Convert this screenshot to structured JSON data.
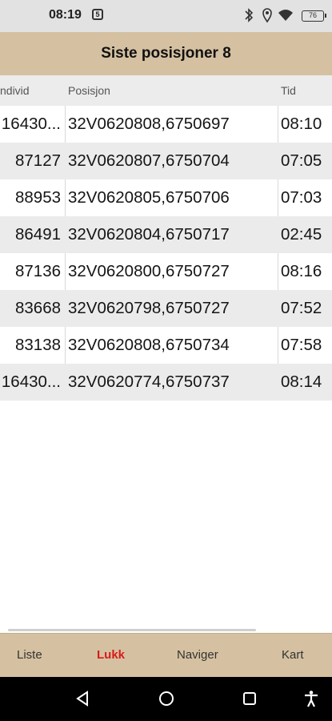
{
  "status_bar": {
    "time": "08:19",
    "notification_glyph": "5",
    "battery_level": "76",
    "icons": [
      "bluetooth-icon",
      "location-icon",
      "wifi-icon",
      "battery-icon"
    ]
  },
  "header": {
    "title": "Siste posisjoner 8"
  },
  "table": {
    "columns": [
      "ndivid",
      "Posisjon",
      "Tid"
    ],
    "rows": [
      {
        "individ": "16430...",
        "posisjon": "32V0620808,6750697",
        "tid": "08:10"
      },
      {
        "individ": "87127",
        "posisjon": "32V0620807,6750704",
        "tid": "07:05"
      },
      {
        "individ": "88953",
        "posisjon": "32V0620805,6750706",
        "tid": "07:03"
      },
      {
        "individ": "86491",
        "posisjon": "32V0620804,6750717",
        "tid": "02:45"
      },
      {
        "individ": "87136",
        "posisjon": "32V0620800,6750727",
        "tid": "08:16"
      },
      {
        "individ": "83668",
        "posisjon": "32V0620798,6750727",
        "tid": "07:52"
      },
      {
        "individ": "83138",
        "posisjon": "32V0620808,6750734",
        "tid": "07:58"
      },
      {
        "individ": "16430...",
        "posisjon": "32V0620774,6750737",
        "tid": "08:14"
      }
    ]
  },
  "tabbar": {
    "tabs": [
      {
        "label": "Liste",
        "active": false
      },
      {
        "label": "Lukk",
        "active": true
      },
      {
        "label": "Naviger",
        "active": false
      },
      {
        "label": "Kart",
        "active": false
      }
    ]
  },
  "navbar": {
    "icons": [
      "back-icon",
      "home-icon",
      "recents-icon",
      "accessibility-icon"
    ]
  },
  "colors": {
    "header_bg": "#d5c1a1",
    "tabbar_bg": "#d5c1a1",
    "active_tab": "#d81b1b",
    "row_alt": "#ebebeb"
  }
}
